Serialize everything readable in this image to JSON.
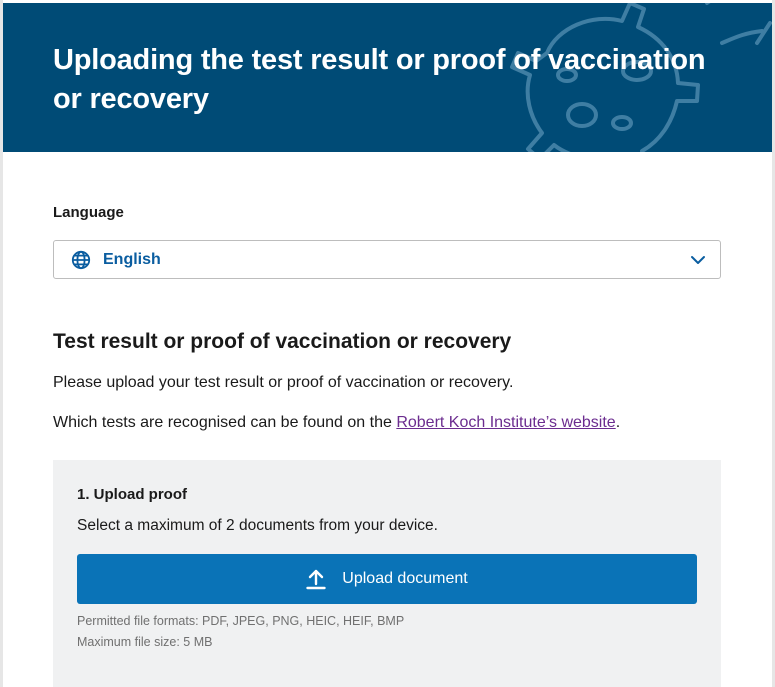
{
  "header": {
    "title": "Uploading the test result or proof of vaccination or recovery"
  },
  "language": {
    "label": "Language",
    "selected": "English",
    "icon": "globe-icon"
  },
  "section": {
    "title": "Test result or proof of vaccination or recovery",
    "intro": "Please upload your test result or proof of vaccination or recovery.",
    "tests_prefix": "Which tests are recognised can be found on the ",
    "tests_link": "Robert Koch Institute’s website",
    "tests_suffix": "."
  },
  "upload": {
    "step_title": "1. Upload proof",
    "step_desc": "Select a maximum of 2 documents from your device.",
    "button_label": "Upload document",
    "formats": "Permitted file formats: PDF, JPEG, PNG, HEIC, HEIF, BMP",
    "max_size": "Maximum file size: 5 MB"
  },
  "colors": {
    "header_bg": "#004b76",
    "accent": "#0a73b7",
    "link": "#6b2c8f",
    "panel_bg": "#f0f1f2"
  }
}
